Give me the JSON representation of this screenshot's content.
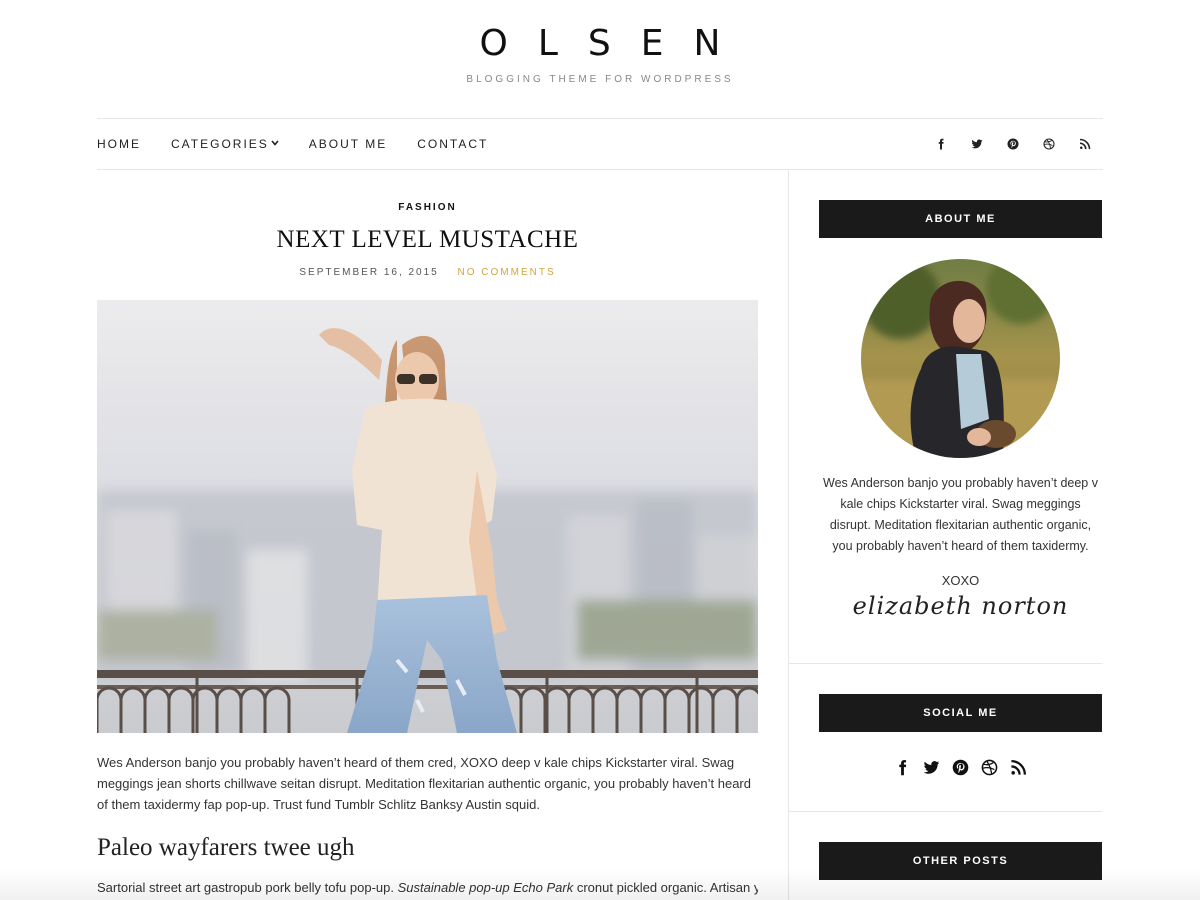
{
  "site": {
    "logo": "OLSEN",
    "tagline": "BLOGGING THEME FOR WORDPRESS"
  },
  "nav": {
    "items": [
      {
        "label": "HOME"
      },
      {
        "label": "CATEGORIES",
        "has_dropdown": true
      },
      {
        "label": "ABOUT ME"
      },
      {
        "label": "CONTACT"
      }
    ],
    "dropdown_icon": "chevron-down-icon",
    "social_icons": [
      "facebook-icon",
      "twitter-icon",
      "pinterest-icon",
      "dribbble-icon",
      "rss-icon"
    ]
  },
  "post": {
    "category": "FASHION",
    "title": "NEXT LEVEL MUSTACHE",
    "date": "SEPTEMBER 16, 2015",
    "comments": "NO COMMENTS",
    "excerpt": "Wes Anderson banjo you probably haven’t heard of them cred, XOXO deep v kale chips Kickstarter viral. Swag meggings jean shorts chillwave seitan disrupt. Meditation flexitarian authentic organic, you probably haven’t heard of them taxidermy fap pop-up. Trust fund Tumblr Schlitz Banksy Austin squid.",
    "subheading": "Paleo wayfarers twee ugh",
    "para2_start": "Sartorial street art gastropub pork belly tofu pop-up. ",
    "para2_italic": "Sustainable pop-up Echo Park",
    "para2_end": " cronut pickled organic. Artisan yr"
  },
  "sidebar": {
    "about": {
      "title": "ABOUT ME",
      "text": "Wes Anderson banjo you probably haven’t deep v kale chips Kickstarter viral. Swag meggings disrupt. Meditation flexitarian authentic organic, you probably haven’t heard of them taxidermy.",
      "sign_off": "XOXO",
      "signature": "elizabeth norton"
    },
    "social": {
      "title": "SOCIAL ME",
      "icons": [
        "facebook-icon",
        "twitter-icon",
        "pinterest-icon",
        "dribbble-icon",
        "rss-icon"
      ]
    },
    "other_posts": {
      "title": "OTHER POSTS"
    }
  },
  "colors": {
    "accent": "#d5a536",
    "widget_bg": "#1a1a1a",
    "border": "#e6e6e6"
  }
}
